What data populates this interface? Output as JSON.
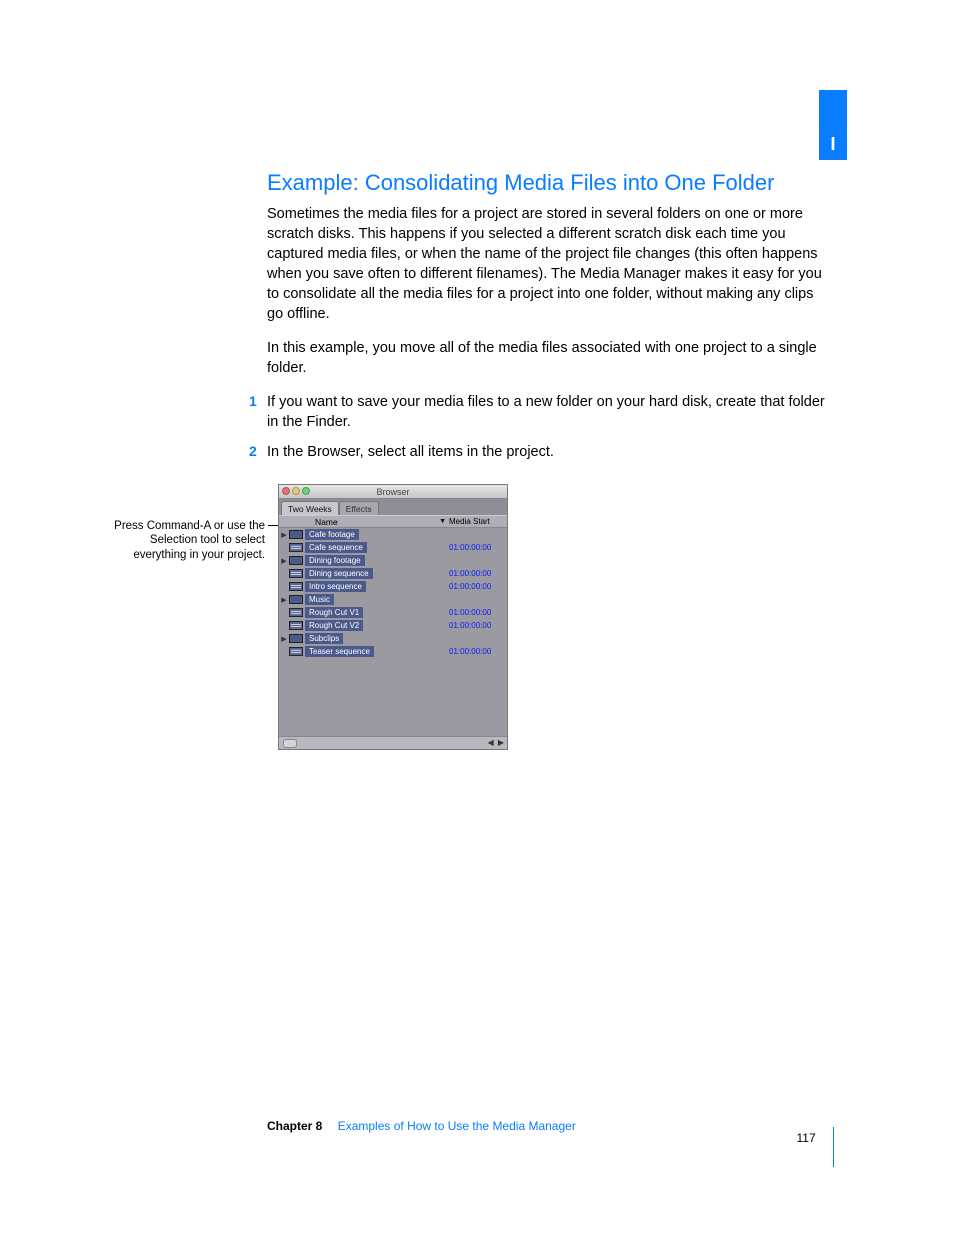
{
  "page_tab_label": "I",
  "heading": "Example:  Consolidating Media Files into One Folder",
  "para1": "Sometimes the media files for a project are stored in several folders on one or more scratch disks. This happens if you selected a different scratch disk each time you captured media files, or when the name of the project file changes (this often happens when you save often to different filenames). The Media Manager makes it easy for you to consolidate all the media files for a project into one folder, without making any clips go offline.",
  "para2": "In this example, you move all of the media files associated with one project to a single folder.",
  "steps": [
    "If you want to save your media files to a new folder on your hard disk, create that folder in the Finder.",
    "In the Browser, select all items in the project."
  ],
  "callout": "Press Command-A or use the Selection tool to select everything in your project.",
  "browser": {
    "title": "Browser",
    "tabs": [
      "Two Weeks",
      "Effects"
    ],
    "columns": {
      "name": "Name",
      "media_start": "Media Start"
    },
    "rows": [
      {
        "type": "folder",
        "disclosure": true,
        "label": "Cafe footage",
        "media": ""
      },
      {
        "type": "seq",
        "disclosure": false,
        "label": "Cafe sequence",
        "media": "01:00:00:00"
      },
      {
        "type": "folder",
        "disclosure": true,
        "label": "Dining footage",
        "media": ""
      },
      {
        "type": "seq",
        "disclosure": false,
        "label": "Dining sequence",
        "media": "01:00:00:00"
      },
      {
        "type": "seq",
        "disclosure": false,
        "label": "Intro sequence",
        "media": "01:00:00:00"
      },
      {
        "type": "folder",
        "disclosure": true,
        "label": "Music",
        "media": ""
      },
      {
        "type": "seq",
        "disclosure": false,
        "label": "Rough Cut V1",
        "media": "01:00:00:00"
      },
      {
        "type": "seq",
        "disclosure": false,
        "label": "Rough Cut V2",
        "media": "01:00:00:00"
      },
      {
        "type": "folder",
        "disclosure": true,
        "label": "Subclips",
        "media": ""
      },
      {
        "type": "seq",
        "disclosure": false,
        "label": "Teaser sequence",
        "media": "01:00:00:00"
      }
    ]
  },
  "footer": {
    "chapter": "Chapter 8",
    "title": "Examples of How to Use the Media Manager",
    "page_number": "117"
  }
}
